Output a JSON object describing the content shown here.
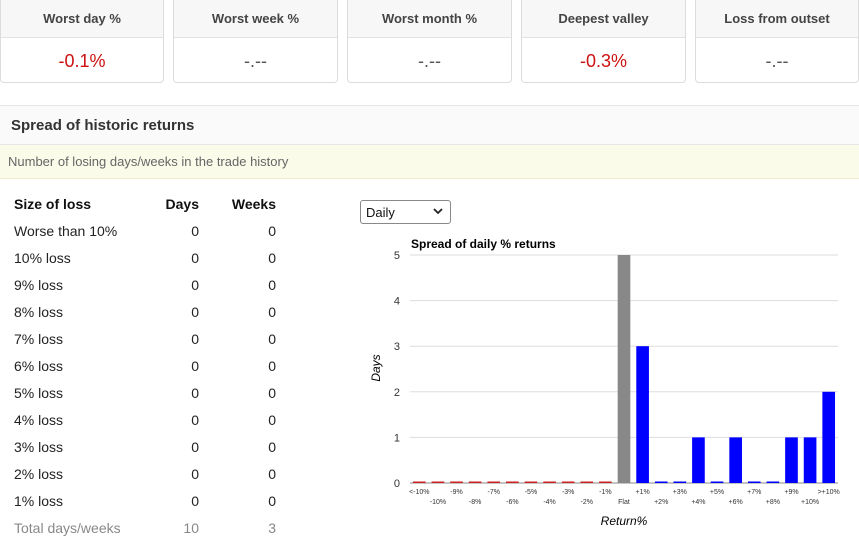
{
  "stats": [
    {
      "label": "Worst day %",
      "value": "-0.1%",
      "negative": true
    },
    {
      "label": "Worst week %",
      "value": "-.--",
      "negative": false
    },
    {
      "label": "Worst month %",
      "value": "-.--",
      "negative": false
    },
    {
      "label": "Deepest valley",
      "value": "-0.3%",
      "negative": true
    },
    {
      "label": "Loss from outset",
      "value": "-.--",
      "negative": false
    }
  ],
  "section": {
    "title": "Spread of historic returns",
    "info": "Number of losing days/weeks in the trade history"
  },
  "table": {
    "headers": [
      "Size of loss",
      "Days",
      "Weeks"
    ],
    "rows": [
      [
        "Worse than 10%",
        "0",
        "0"
      ],
      [
        "10% loss",
        "0",
        "0"
      ],
      [
        "9% loss",
        "0",
        "0"
      ],
      [
        "8% loss",
        "0",
        "0"
      ],
      [
        "7% loss",
        "0",
        "0"
      ],
      [
        "6% loss",
        "0",
        "0"
      ],
      [
        "5% loss",
        "0",
        "0"
      ],
      [
        "4% loss",
        "0",
        "0"
      ],
      [
        "3% loss",
        "0",
        "0"
      ],
      [
        "2% loss",
        "0",
        "0"
      ],
      [
        "1% loss",
        "0",
        "0"
      ]
    ],
    "total": [
      "Total days/weeks",
      "10",
      "3"
    ]
  },
  "period_select": {
    "selected": "Daily",
    "icon": "chevron-down-icon"
  },
  "chart_data": {
    "type": "bar",
    "title": "Spread of daily % returns",
    "xlabel": "Return%",
    "ylabel": "Days",
    "ylim": [
      0,
      5
    ],
    "yticks": [
      0,
      1,
      2,
      3,
      4,
      5
    ],
    "grid": true,
    "categories": [
      "<-10%",
      "-10%",
      "-9%",
      "-8%",
      "-7%",
      "-6%",
      "-5%",
      "-4%",
      "-3%",
      "-2%",
      "-1%",
      "Flat",
      "+1%",
      "+2%",
      "+3%",
      "+4%",
      "+5%",
      "+6%",
      "+7%",
      "+8%",
      "+9%",
      "+10%",
      ">+10%"
    ],
    "values": [
      0,
      0,
      0,
      0,
      0,
      0,
      0,
      0,
      0,
      0,
      0,
      5,
      3,
      0,
      0,
      1,
      0,
      1,
      0,
      0,
      1,
      1,
      2
    ],
    "colors": {
      "loss": "#cc2222",
      "flat": "#888888",
      "gain": "#0000ff"
    }
  }
}
